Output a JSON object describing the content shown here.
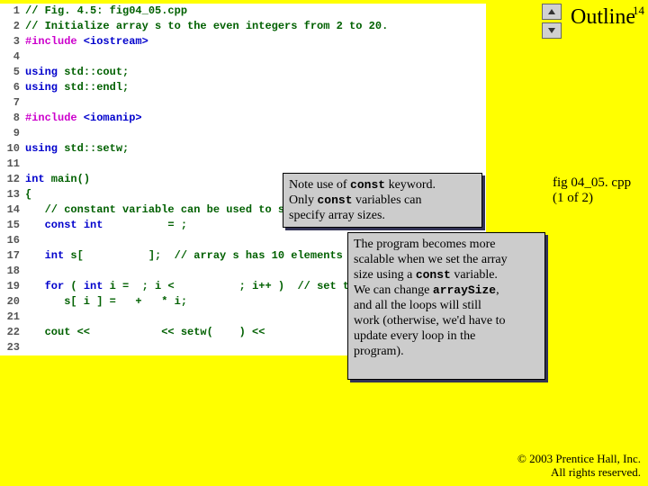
{
  "page_number": "14",
  "outline_title": "Outline",
  "side_label_file": "fig 04_05. cpp",
  "side_label_part": "(1 of 2)",
  "copyright_line1": "© 2003 Prentice Hall, Inc.",
  "copyright_line2": "All rights reserved.",
  "gutter": "1\n2\n3\n4\n5\n6\n7\n8\n9\n10\n11\n12\n13\n14\n15\n16\n17\n18\n19\n20\n21\n22\n23",
  "code": {
    "l1": "// Fig. 4.5: fig04_05.cpp",
    "l2": "// Initialize array s to the even integers from 2 to 20.",
    "l3a": "#include",
    "l3b": " <iostream>",
    "l5a": "using",
    "l5b": " std::cout;",
    "l6a": "using",
    "l6b": " std::endl;",
    "l8a": "#include",
    "l8b": " <iomanip>",
    "l10a": "using",
    "l10b": " std::setw;",
    "l12a": "int",
    "l12b": " main()",
    "l13": "{",
    "l14a": "   ",
    "l14b": "// constant variable can be used to specify array size",
    "l15a": "   ",
    "l15b": "const int",
    "l15c": "          = ",
    "l15d": ";",
    "l17a": "   ",
    "l17b": "int",
    "l17c": " s[          ];  ",
    "l17d": "// array s has 10 elements",
    "l19a": "   ",
    "l19b": "for",
    "l19c": " ( ",
    "l19d": "int",
    "l19e": " i =  ; i <          ; i++ )  ",
    "l19f": "// set the values",
    "l20a": "      s[ i ] =   +   * i;",
    "l22a": "   cout <<           << setw(    ) << "
  },
  "callout1_l1": "Note use of ",
  "callout1_kw1": "const",
  "callout1_l1b": " keyword.",
  "callout1_l2a": "Only ",
  "callout1_kw2": "const",
  "callout1_l2b": " variables can",
  "callout1_l3": "specify array sizes.",
  "callout2_l1": "The program becomes more",
  "callout2_l2": "scalable when we set the array",
  "callout2_l3a": "size using a ",
  "callout2_kw1": "const",
  "callout2_l3b": " variable.",
  "callout2_l4a": "We can change ",
  "callout2_kw2": "arraySize",
  "callout2_l4b": ",",
  "callout2_l5": "and all the loops will still",
  "callout2_l6": "work (otherwise, we'd have to",
  "callout2_l7": "update every loop in the",
  "callout2_l8": "program)."
}
